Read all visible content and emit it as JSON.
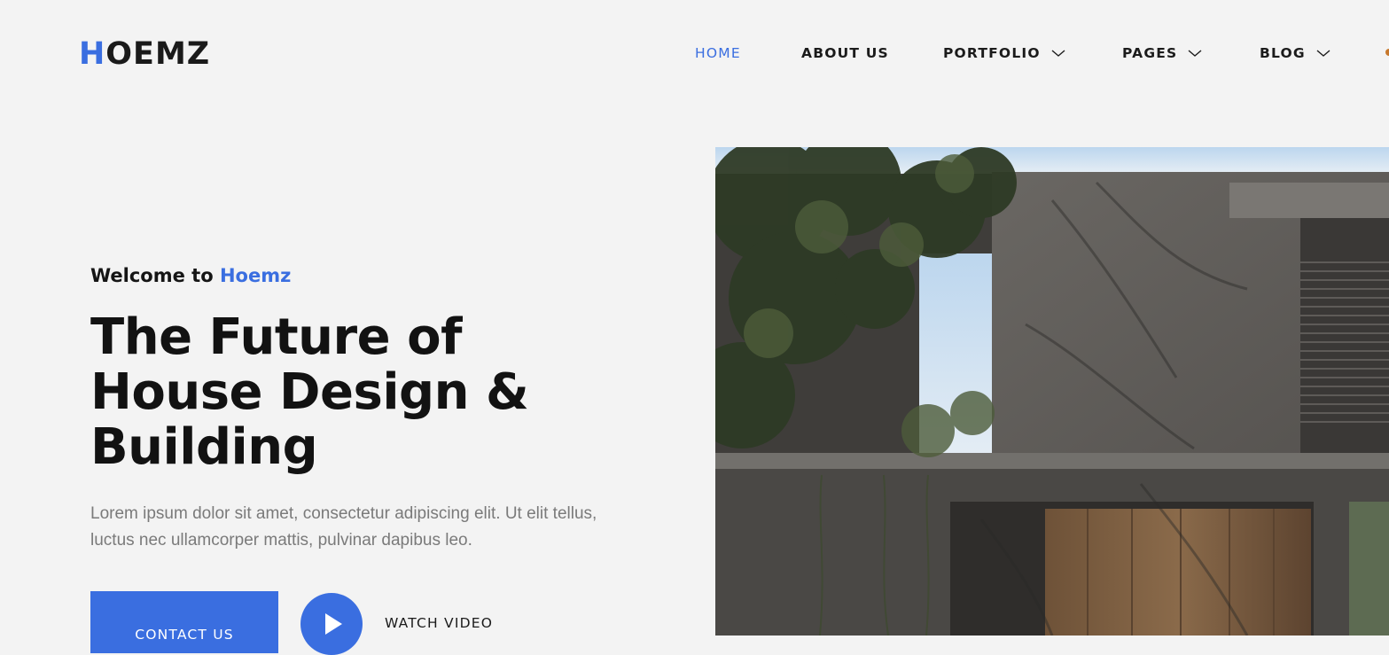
{
  "header": {
    "logo": {
      "first_letter": "H",
      "rest": "OEMZ"
    },
    "nav": [
      {
        "label": "HOME",
        "active": true,
        "has_dropdown": false
      },
      {
        "label": "ABOUT US",
        "active": false,
        "has_dropdown": false
      },
      {
        "label": "PORTFOLIO",
        "active": false,
        "has_dropdown": true
      },
      {
        "label": "PAGES",
        "active": false,
        "has_dropdown": true
      },
      {
        "label": "BLOG",
        "active": false,
        "has_dropdown": true
      }
    ]
  },
  "hero": {
    "welcome_prefix": "Welcome to",
    "welcome_brand": "Hoemz",
    "headline_lines": [
      "The Future of",
      "House Design &",
      "Building"
    ],
    "lead": "Lorem ipsum dolor sit amet, consectetur adipiscing elit. Ut elit tellus, luctus nec ullamcorper mattis, pulvinar dapibus leo.",
    "contact_label": "CONTACT US",
    "watch_label": "WATCH VIDEO",
    "play_icon": "play-icon",
    "image_icon": "house-photo"
  },
  "colors": {
    "accent": "#3a6ee0",
    "background": "#f3f3f3",
    "text": "#121212",
    "muted_text": "#7a7a7a"
  }
}
